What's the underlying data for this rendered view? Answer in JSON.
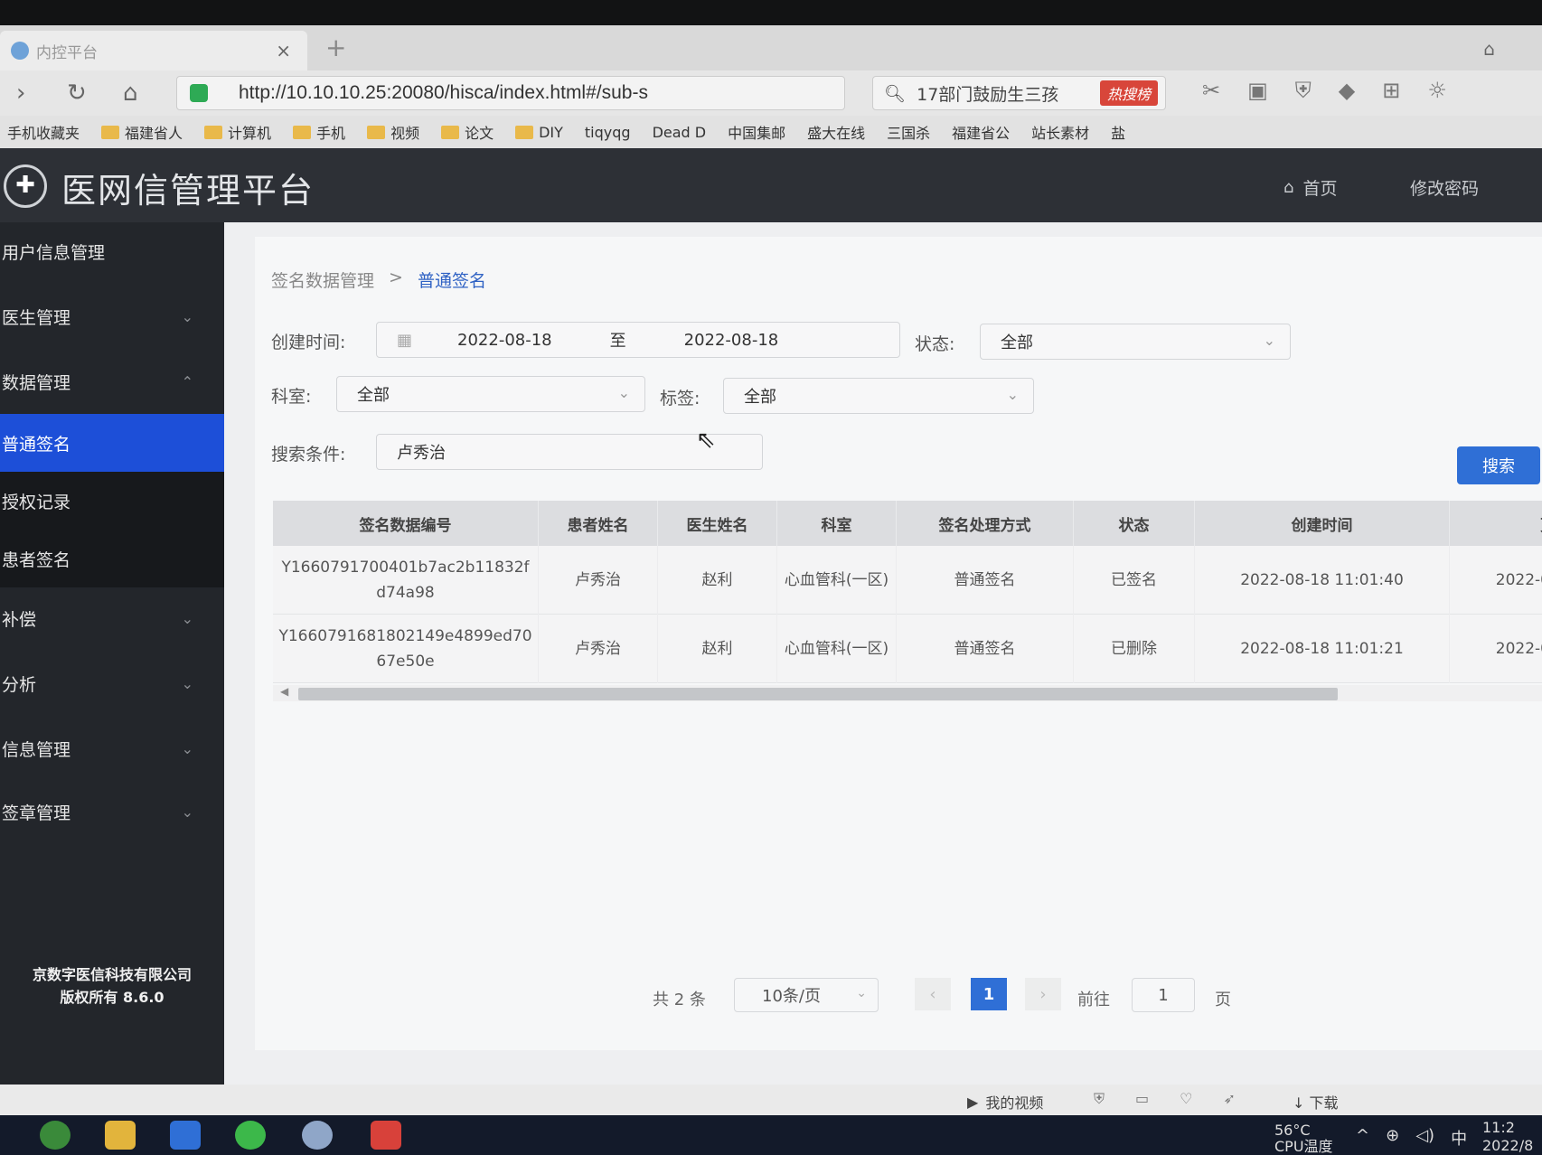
{
  "browser": {
    "tab_title": "内控平台",
    "url": "http://10.10.10.25:20080/hisca/index.html#/sub-s",
    "search_text": "17部门鼓励生三孩",
    "search_badge": "热搜榜",
    "bookmarks": [
      "手机收藏夹",
      "福建省人",
      "计算机",
      "手机",
      "视频",
      "论文",
      "DIY",
      "tiqyqg",
      "Dead D",
      "中国集邮",
      "盛大在线",
      "三国杀",
      "福建省公",
      "站长素材",
      "盐"
    ]
  },
  "app": {
    "title": "医网信管理平台",
    "nav_home": "首页",
    "nav_change_password": "修改密码"
  },
  "sidebar": {
    "items": [
      {
        "label": "用户信息管理",
        "chevron": ""
      },
      {
        "label": "医生管理",
        "chevron": "⌄"
      },
      {
        "label": "数据管理",
        "chevron": "⌃"
      },
      {
        "label": "普通签名",
        "chevron": ""
      },
      {
        "label": "授权记录",
        "chevron": ""
      },
      {
        "label": "患者签名",
        "chevron": ""
      },
      {
        "label": "补偿",
        "chevron": "⌄"
      },
      {
        "label": "分析",
        "chevron": "⌄"
      },
      {
        "label": "信息管理",
        "chevron": "⌄"
      },
      {
        "label": "签章管理",
        "chevron": "⌄"
      }
    ],
    "copyright_line1": "京数字医信科技有限公司",
    "copyright_line2": "版权所有 8.6.0"
  },
  "breadcrumb": {
    "parent": "签名数据管理",
    "separator": ">",
    "current": "普通签名"
  },
  "filters": {
    "created_label": "创建时间:",
    "date_from": "2022-08-18",
    "date_sep": "至",
    "date_to": "2022-08-18",
    "status_label": "状态:",
    "status_value": "全部",
    "dept_label": "科室:",
    "dept_value": "全部",
    "tag_label": "标签:",
    "tag_value": "全部",
    "search_label": "搜索条件:",
    "search_value": "卢秀治",
    "search_button": "搜索"
  },
  "table": {
    "headers": [
      "签名数据编号",
      "患者姓名",
      "医生姓名",
      "科室",
      "签名处理方式",
      "状态",
      "创建时间",
      "更"
    ],
    "rows": [
      [
        "Y1660791700401b7ac2b11832fd74a98",
        "卢秀治",
        "赵利",
        "心血管科(一区)",
        "普通签名",
        "已签名",
        "2022-08-18 11:01:40",
        "2022-0"
      ],
      [
        "Y1660791681802149e4899ed7067e50e",
        "卢秀治",
        "赵利",
        "心血管科(一区)",
        "普通签名",
        "已删除",
        "2022-08-18 11:01:21",
        "2022-0"
      ]
    ]
  },
  "pagination": {
    "total": "共 2 条",
    "page_size": "10条/页",
    "current_page": "1",
    "goto_label": "前往",
    "goto_value": "1",
    "page_suffix": "页"
  },
  "statusbar": {
    "my_video": "我的视频",
    "download": "下载"
  },
  "taskbar": {
    "temp": "56°C",
    "temp_label": "CPU温度",
    "ime": "中",
    "time": "11:2",
    "date": "2022/8"
  }
}
